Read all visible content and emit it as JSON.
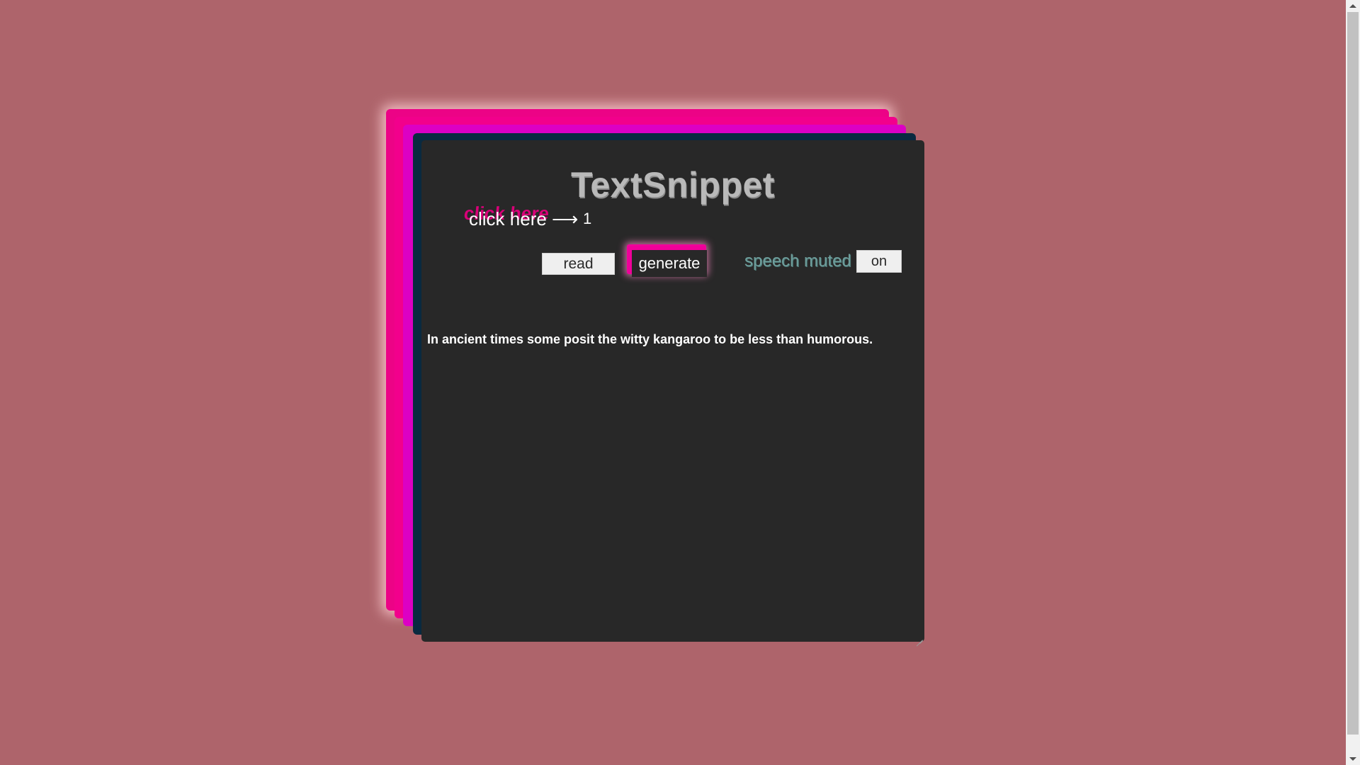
{
  "app": {
    "title": "TextSnippet"
  },
  "controls": {
    "click_label": "click here ⟶",
    "click_shadow_label": "click here",
    "counter": "1",
    "read_label": "read",
    "generate_label": "generate",
    "speech_label": "speech muted",
    "speech_toggle_label": "on"
  },
  "snippet": {
    "text": "In ancient times some posit the witty kangaroo to be less than humorous."
  },
  "colors": {
    "background": "#ae646b",
    "card": "#282828",
    "accent_pink": "#f2008c",
    "accent_magenta": "#dc00c4",
    "accent_navy": "#0a2a40",
    "speech_label": "#6e9e9c"
  }
}
